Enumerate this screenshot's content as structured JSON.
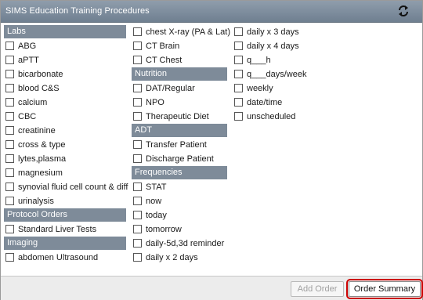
{
  "window": {
    "title": "SIMS Education Training Procedures",
    "refresh_icon": "refresh-arrows-icon"
  },
  "sections": {
    "labs": {
      "header": "Labs",
      "items": [
        "ABG",
        "aPTT",
        "bicarbonate",
        "blood C&S",
        "calcium",
        "CBC",
        "creatinine",
        "cross & type",
        "lytes,plasma",
        "magnesium",
        "synovial fluid cell count & diff",
        "urinalysis"
      ]
    },
    "protocol_orders": {
      "header": "Protocol Orders",
      "items": [
        "Standard Liver Tests"
      ]
    },
    "imaging": {
      "header": "Imaging",
      "items": [
        "abdomen Ultrasound",
        "chest X-ray (PA & Lat)",
        "CT Brain",
        "CT Chest"
      ]
    },
    "nutrition": {
      "header": "Nutrition",
      "items": [
        "DAT/Regular",
        "NPO",
        "Therapeutic Diet"
      ]
    },
    "adt": {
      "header": "ADT",
      "items": [
        "Transfer Patient",
        "Discharge Patient"
      ]
    },
    "frequencies": {
      "header": "Frequencies",
      "items": [
        "STAT",
        "now",
        "today",
        "tomorrow",
        "daily-5d,3d reminder",
        "daily x 2 days",
        "daily x 3 days",
        "daily x 4 days",
        "q___h",
        "q___days/week",
        "weekly",
        "date/time",
        "unscheduled"
      ]
    }
  },
  "footer": {
    "add_order": "Add Order",
    "order_summary": "Order Summary"
  },
  "colors": {
    "titlebar": "#7f8d9c",
    "section_header": "#7e8b99",
    "highlight_outline": "#cc0000"
  }
}
